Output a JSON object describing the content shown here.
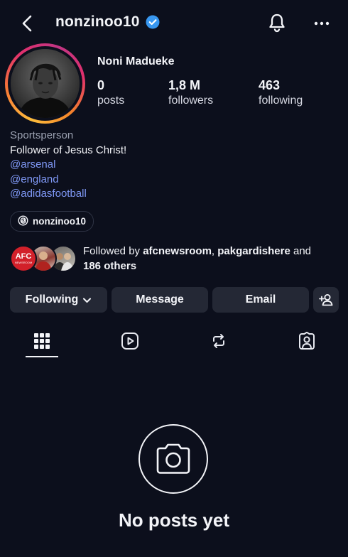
{
  "header": {
    "username": "nonzinoo10"
  },
  "profile": {
    "full_name": "Noni Madueke",
    "stats": [
      {
        "value": "0",
        "label": "posts"
      },
      {
        "value": "1,8 M",
        "label": "followers"
      },
      {
        "value": "463",
        "label": "following"
      }
    ]
  },
  "bio": {
    "category": "Sportsperson",
    "text": "Follower of Jesus Christ!",
    "links": [
      "@arsenal",
      "@england",
      "@adidasfootball"
    ]
  },
  "threads": {
    "handle": "nonzinoo10"
  },
  "followed_by": {
    "prefix": "Followed by ",
    "names": [
      "afcnewsroom",
      "pakgardishere"
    ],
    "separator": ", ",
    "and": " and ",
    "others": "186 others",
    "afc_logo_text": "AFC",
    "afc_logo_sub": "NEWSROOM"
  },
  "actions": {
    "following": "Following",
    "message": "Message",
    "email": "Email"
  },
  "tabs": [
    "grid-icon",
    "reels-icon",
    "reposts-icon",
    "tagged-icon"
  ],
  "empty_state": {
    "title": "No posts yet"
  },
  "colors": {
    "background": "#0c0f1c",
    "button": "#242835",
    "link": "#7f98f5",
    "verified": "#3897f0"
  }
}
